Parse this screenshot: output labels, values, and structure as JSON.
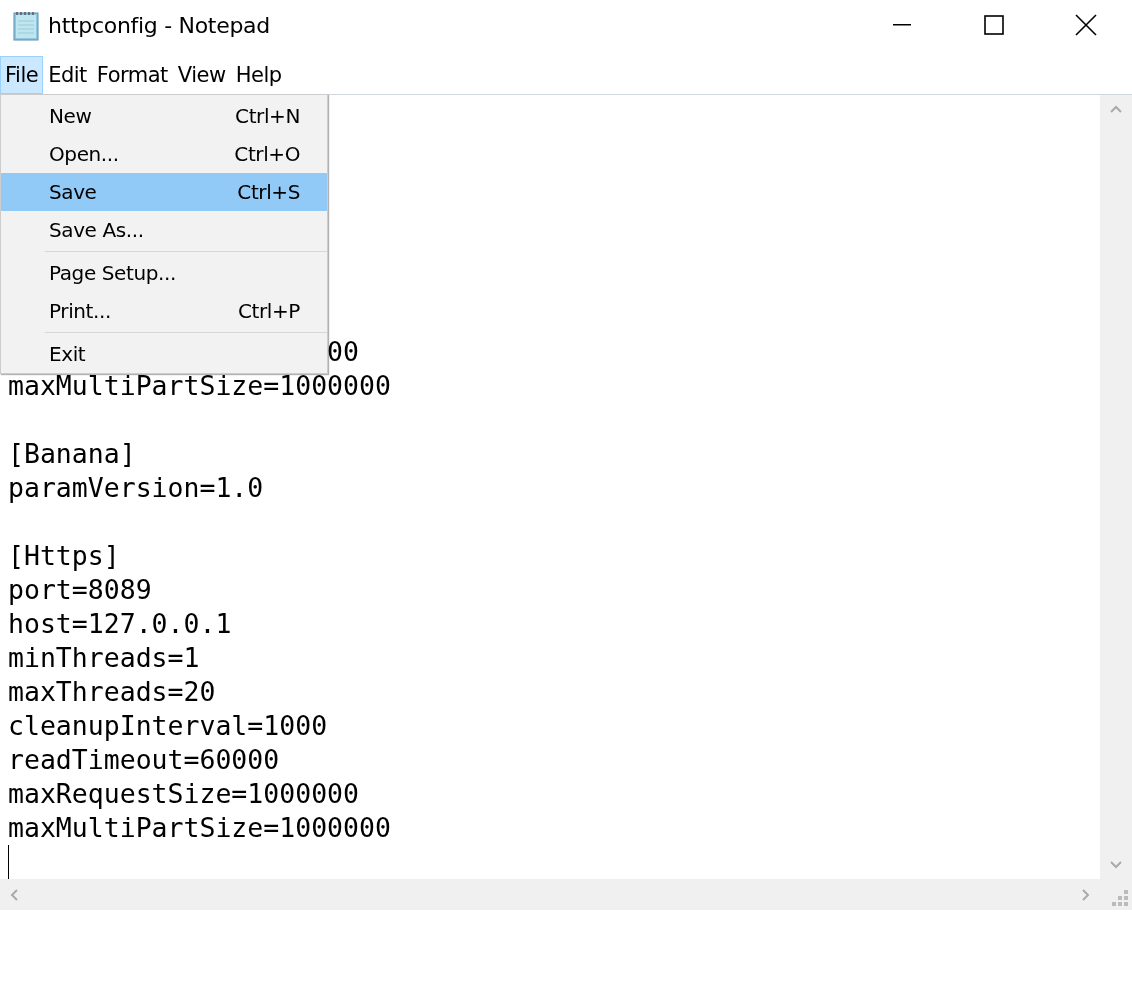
{
  "window": {
    "title": "httpconfig - Notepad"
  },
  "menu_bar": [
    {
      "label": "File",
      "selected": true
    },
    {
      "label": "Edit",
      "selected": false
    },
    {
      "label": "Format",
      "selected": false
    },
    {
      "label": "View",
      "selected": false
    },
    {
      "label": "Help",
      "selected": false
    }
  ],
  "file_menu": [
    {
      "kind": "item",
      "label": "New",
      "shortcut": "Ctrl+N",
      "selected": false
    },
    {
      "kind": "item",
      "label": "Open...",
      "shortcut": "Ctrl+O",
      "selected": false
    },
    {
      "kind": "item",
      "label": "Save",
      "shortcut": "Ctrl+S",
      "selected": true
    },
    {
      "kind": "item",
      "label": "Save As...",
      "selected": false
    },
    {
      "kind": "separator"
    },
    {
      "kind": "item",
      "label": "Page Setup...",
      "selected": false
    },
    {
      "kind": "item",
      "label": "Print...",
      "shortcut": "Ctrl+P",
      "selected": false
    },
    {
      "kind": "separator"
    },
    {
      "kind": "item",
      "label": "Exit",
      "selected": false
    }
  ],
  "editor": {
    "caret": true,
    "lines": [
      {
        "kind": "hidden"
      },
      {
        "kind": "hidden"
      },
      {
        "kind": "hidden"
      },
      {
        "kind": "hidden"
      },
      {
        "kind": "hidden"
      },
      {
        "kind": "hidden"
      },
      {
        "kind": "hidden"
      },
      {
        "kind": "partial",
        "text": "00"
      },
      {
        "kind": "text",
        "text": "maxMultiPartSize=1000000"
      },
      {
        "kind": "blank"
      },
      {
        "kind": "text",
        "text": "[Banana]"
      },
      {
        "kind": "text",
        "text": "paramVersion=1.0"
      },
      {
        "kind": "blank"
      },
      {
        "kind": "text",
        "text": "[Https]"
      },
      {
        "kind": "text",
        "text": "port=8089"
      },
      {
        "kind": "text",
        "text": "host=127.0.0.1"
      },
      {
        "kind": "text",
        "text": "minThreads=1"
      },
      {
        "kind": "text",
        "text": "maxThreads=20"
      },
      {
        "kind": "text",
        "text": "cleanupInterval=1000"
      },
      {
        "kind": "text",
        "text": "readTimeout=60000"
      },
      {
        "kind": "text",
        "text": "maxRequestSize=1000000"
      },
      {
        "kind": "text",
        "text": "maxMultiPartSize=1000000"
      }
    ]
  }
}
